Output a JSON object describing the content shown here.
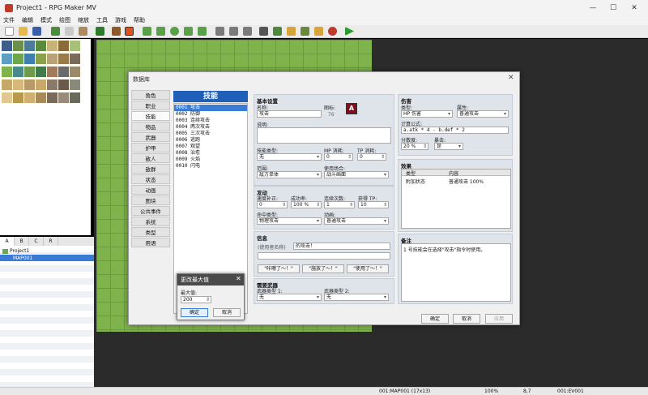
{
  "window": {
    "title": "Project1 - RPG Maker MV",
    "minimize": "—",
    "maximize": "☐",
    "close": "✕"
  },
  "menu": [
    "文件",
    "编辑",
    "模式",
    "绘图",
    "缩放",
    "工具",
    "游戏",
    "帮助"
  ],
  "left_tabs": [
    "A",
    "B",
    "C",
    "R"
  ],
  "map_tree": {
    "project": "Project1",
    "map": "MAP001"
  },
  "statusbar": {
    "map": "001:MAP001 (17x13)",
    "zoom": "100%",
    "coords": "8,7",
    "event": "001:EV001"
  },
  "database": {
    "title": "数据库",
    "close": "✕",
    "categories": [
      "角色",
      "职业",
      "技能",
      "物品",
      "武器",
      "护甲",
      "敌人",
      "敌群",
      "状态",
      "动画",
      "图块",
      "公共事件",
      "系统",
      "类型",
      "用语"
    ],
    "active_category": "技能",
    "list_title": "技能",
    "skills": [
      "0001 攻击",
      "0002 防御",
      "0003 连续攻击",
      "0004 两次攻击",
      "0005 三次攻击",
      "0006 逃跑",
      "0007 观望",
      "0008 治愈",
      "0009 火焰",
      "0010 闪电"
    ],
    "basic": {
      "head": "基本设置",
      "name_label": "名称:",
      "name": "攻击",
      "icon_label": "图标:",
      "icon_index": "76",
      "desc_label": "说明:",
      "skill_type_label": "技能类型:",
      "skill_type": "无",
      "mp_label": "MP 消耗:",
      "mp": "0",
      "tp_label": "TP 消耗:",
      "tp": "0",
      "scope_label": "范围:",
      "scope": "敌方单体",
      "occasion_label": "使用场合:",
      "occasion": "战斗画面"
    },
    "invocation": {
      "head": "发动",
      "speed_label": "速度补正:",
      "speed": "0",
      "success_label": "成功率:",
      "success": "100 %",
      "repeat_label": "连续次数:",
      "repeat": "1",
      "tpgain_label": "获得 TP:",
      "tpgain": "10",
      "hit_label": "命中类型:",
      "hit": "物理攻击",
      "anim_label": "动画:",
      "anim": "普通攻击"
    },
    "message": {
      "head": "信息",
      "user_label": "(使用者名称)",
      "line1": "的攻击！",
      "line2": "",
      "btn1": "\"咔嚓了～！\"",
      "btn2": "\"施放了～！\"",
      "btn3": "\"使用了～！\""
    },
    "weapons": {
      "head": "需要武器",
      "w1_label": "武器类型 1:",
      "w1": "无",
      "w2_label": "武器类型 2:",
      "w2": "无"
    },
    "damage": {
      "head": "伤害",
      "type_label": "类型:",
      "type": "HP 伤害",
      "element_label": "属性:",
      "element": "普通攻击",
      "formula_label": "计算公式:",
      "formula": "a.atk * 4 - b.def * 2",
      "variance_label": "分散度:",
      "variance": "20 %",
      "crit_label": "暴击:",
      "crit": "是"
    },
    "effects": {
      "head": "效果",
      "col_type": "类型",
      "col_content": "内容",
      "row_type": "附加状态",
      "row_content": "普通攻击 100%"
    },
    "note": {
      "head": "备注",
      "text": "1 号技能会在选择\"攻击\"指令时使用。"
    },
    "buttons": {
      "ok": "确定",
      "cancel": "取消",
      "apply": "应用"
    }
  },
  "max_dialog": {
    "title": "更改最大值",
    "close": "✕",
    "label": "最大值:",
    "value": "200",
    "ok": "确定",
    "cancel": "取消"
  },
  "colors": {
    "accent": "#1f5fb8",
    "selection": "#3a7bd5",
    "grass": "#7fb34c"
  }
}
